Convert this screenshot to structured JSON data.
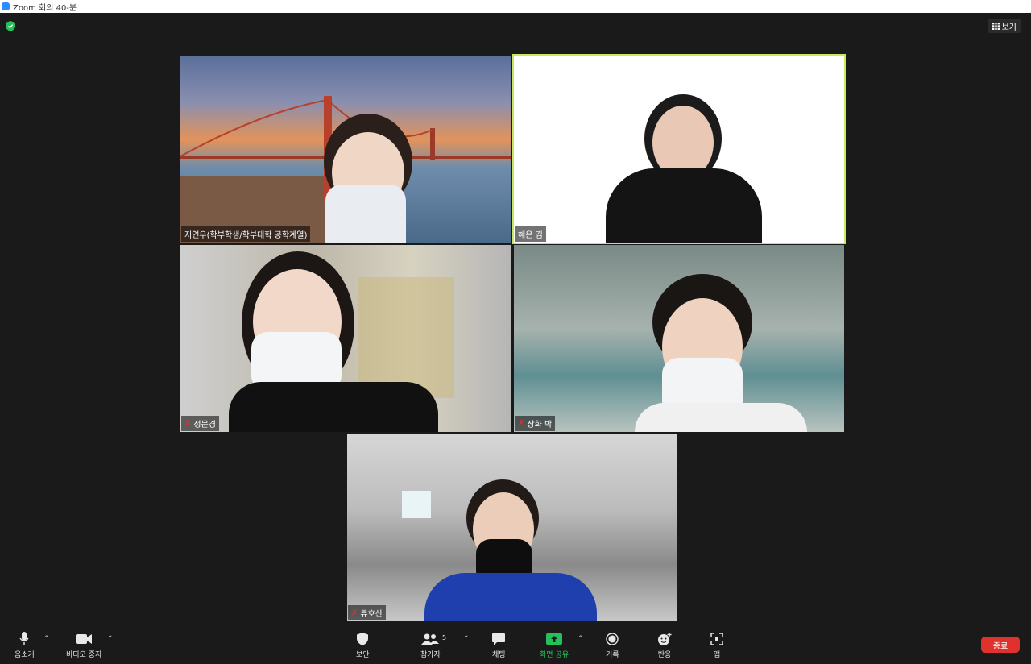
{
  "window": {
    "title": "Zoom 회의 40-분"
  },
  "header": {
    "view_label": "보기"
  },
  "participants": [
    {
      "name": "지연우(학부학생/학부대학 공학계열)",
      "muted": false
    },
    {
      "name": "혜은 김",
      "muted": false,
      "active_speaker": true
    },
    {
      "name": "정문경",
      "muted": true
    },
    {
      "name": "상화 박",
      "muted": true
    },
    {
      "name": "류호산",
      "muted": true
    }
  ],
  "toolbar": {
    "mute_label": "음소거",
    "video_label": "비디오 중지",
    "security_label": "보안",
    "participants_label": "참가자",
    "participants_count": "5",
    "chat_label": "채팅",
    "share_label": "화면 공유",
    "record_label": "기록",
    "reactions_label": "반응",
    "apps_label": "앱",
    "end_label": "종료"
  },
  "colors": {
    "accent_green": "#25c05a",
    "active_border": "#c9e85b",
    "end_red": "#e0322c",
    "zoom_blue": "#2d8cff"
  }
}
